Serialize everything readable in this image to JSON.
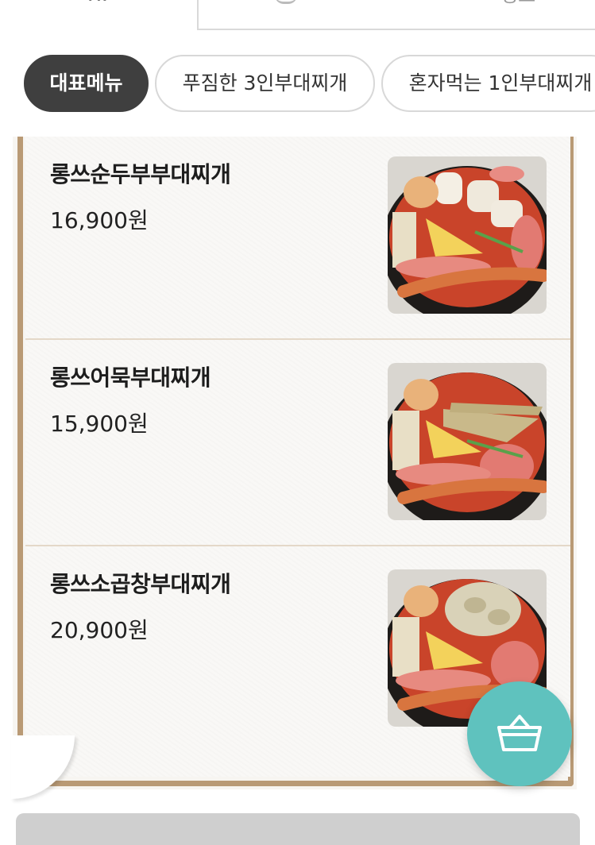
{
  "tabs": {
    "left_label": "메뉴",
    "right_label": "정보"
  },
  "categories": [
    {
      "label": "대표메뉴",
      "active": true
    },
    {
      "label": "푸짐한 3인부대찌개",
      "active": false
    },
    {
      "label": "혼자먹는 1인부대찌개",
      "active": false
    }
  ],
  "menu_items": [
    {
      "name": "롱쓰순두부부대찌개",
      "price": "16,900원",
      "photo": "sundubu-budae-jjigae-photo"
    },
    {
      "name": "롱쓰어묵부대찌개",
      "price": "15,900원",
      "photo": "eomuk-budae-jjigae-photo"
    },
    {
      "name": "롱쓰소곱창부대찌개",
      "price": "20,900원",
      "photo": "sogopchang-budae-jjigae-photo"
    }
  ],
  "icons": {
    "cart": "shopping-basket-icon"
  },
  "colors": {
    "accent": "#5fc2be",
    "active_chip": "#3f3f3f",
    "card_border": "#b99a75"
  }
}
